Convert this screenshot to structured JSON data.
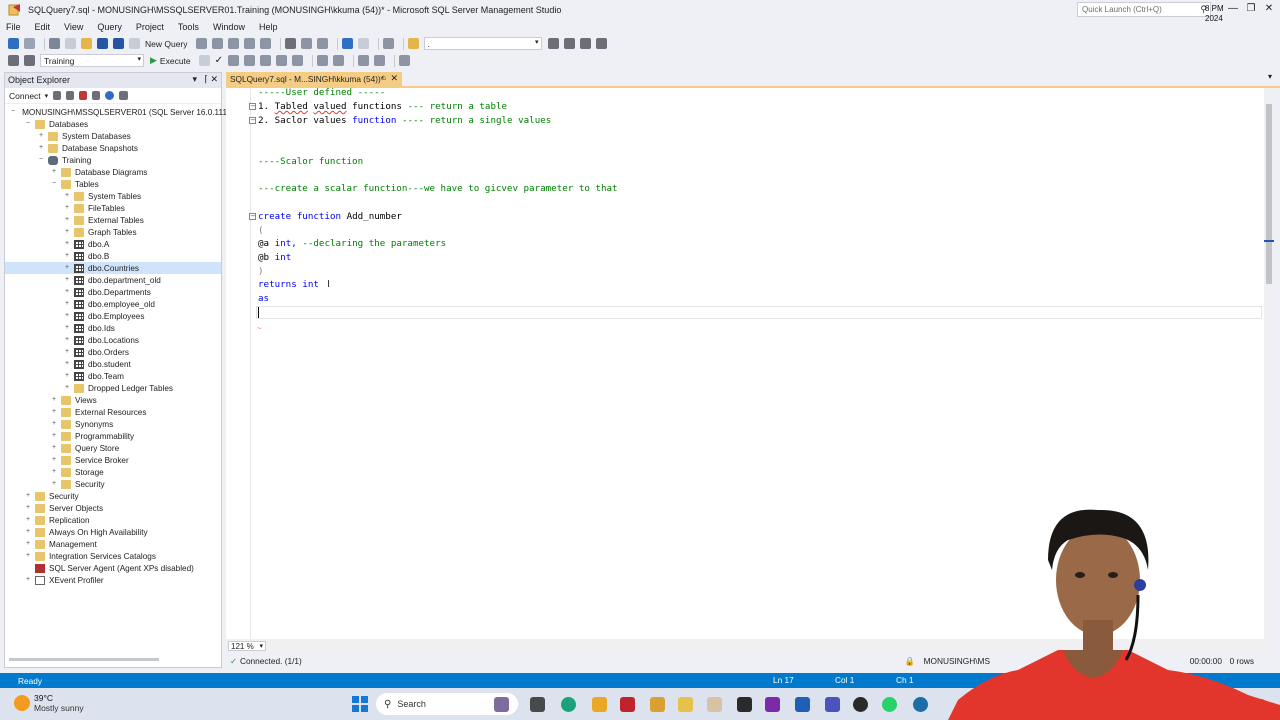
{
  "window": {
    "title": "SQLQuery7.sql - MONUSINGH\\MSSQLSERVER01.Training (MONUSINGH\\kkuma (54))* - Microsoft SQL Server Management Studio",
    "quick_launch_placeholder": "Quick Launch (Ctrl+Q)"
  },
  "menu": [
    "File",
    "Edit",
    "View",
    "Query",
    "Project",
    "Tools",
    "Window",
    "Help"
  ],
  "toolbar": {
    "new_query": "New Query",
    "database_combo": "Training",
    "execute": "Execute",
    "solution_combo": "."
  },
  "object_explorer": {
    "title": "Object Explorer",
    "connect": "Connect",
    "nodes": [
      {
        "label": "MONUSINGH\\MSSQLSERVER01 (SQL Server 16.0.1115",
        "depth": 0,
        "expander": "−",
        "icon": "server"
      },
      {
        "label": "Databases",
        "depth": 1,
        "expander": "−",
        "icon": "folder"
      },
      {
        "label": "System Databases",
        "depth": 2,
        "expander": "+",
        "icon": "folder"
      },
      {
        "label": "Database Snapshots",
        "depth": 2,
        "expander": "+",
        "icon": "folder"
      },
      {
        "label": "Training",
        "depth": 2,
        "expander": "−",
        "icon": "db"
      },
      {
        "label": "Database Diagrams",
        "depth": 3,
        "expander": "+",
        "icon": "folder"
      },
      {
        "label": "Tables",
        "depth": 3,
        "expander": "−",
        "icon": "folder"
      },
      {
        "label": "System Tables",
        "depth": 4,
        "expander": "+",
        "icon": "folder"
      },
      {
        "label": "FileTables",
        "depth": 4,
        "expander": "+",
        "icon": "folder"
      },
      {
        "label": "External Tables",
        "depth": 4,
        "expander": "+",
        "icon": "folder"
      },
      {
        "label": "Graph Tables",
        "depth": 4,
        "expander": "+",
        "icon": "folder"
      },
      {
        "label": "dbo.A",
        "depth": 4,
        "expander": "+",
        "icon": "table"
      },
      {
        "label": "dbo.B",
        "depth": 4,
        "expander": "+",
        "icon": "table"
      },
      {
        "label": "dbo.Countries",
        "depth": 4,
        "expander": "+",
        "icon": "table",
        "selected": true
      },
      {
        "label": "dbo.department_old",
        "depth": 4,
        "expander": "+",
        "icon": "table"
      },
      {
        "label": "dbo.Departments",
        "depth": 4,
        "expander": "+",
        "icon": "table"
      },
      {
        "label": "dbo.employee_old",
        "depth": 4,
        "expander": "+",
        "icon": "table"
      },
      {
        "label": "dbo.Employees",
        "depth": 4,
        "expander": "+",
        "icon": "table"
      },
      {
        "label": "dbo.Ids",
        "depth": 4,
        "expander": "+",
        "icon": "table"
      },
      {
        "label": "dbo.Locations",
        "depth": 4,
        "expander": "+",
        "icon": "table"
      },
      {
        "label": "dbo.Orders",
        "depth": 4,
        "expander": "+",
        "icon": "table"
      },
      {
        "label": "dbo.student",
        "depth": 4,
        "expander": "+",
        "icon": "table"
      },
      {
        "label": "dbo.Team",
        "depth": 4,
        "expander": "+",
        "icon": "table"
      },
      {
        "label": "Dropped Ledger Tables",
        "depth": 4,
        "expander": "+",
        "icon": "folder"
      },
      {
        "label": "Views",
        "depth": 3,
        "expander": "+",
        "icon": "folder"
      },
      {
        "label": "External Resources",
        "depth": 3,
        "expander": "+",
        "icon": "folder"
      },
      {
        "label": "Synonyms",
        "depth": 3,
        "expander": "+",
        "icon": "folder"
      },
      {
        "label": "Programmability",
        "depth": 3,
        "expander": "+",
        "icon": "folder"
      },
      {
        "label": "Query Store",
        "depth": 3,
        "expander": "+",
        "icon": "folder"
      },
      {
        "label": "Service Broker",
        "depth": 3,
        "expander": "+",
        "icon": "folder"
      },
      {
        "label": "Storage",
        "depth": 3,
        "expander": "+",
        "icon": "folder"
      },
      {
        "label": "Security",
        "depth": 3,
        "expander": "+",
        "icon": "folder"
      },
      {
        "label": "Security",
        "depth": 1,
        "expander": "+",
        "icon": "folder"
      },
      {
        "label": "Server Objects",
        "depth": 1,
        "expander": "+",
        "icon": "folder"
      },
      {
        "label": "Replication",
        "depth": 1,
        "expander": "+",
        "icon": "folder"
      },
      {
        "label": "Always On High Availability",
        "depth": 1,
        "expander": "+",
        "icon": "folder"
      },
      {
        "label": "Management",
        "depth": 1,
        "expander": "+",
        "icon": "folder"
      },
      {
        "label": "Integration Services Catalogs",
        "depth": 1,
        "expander": "+",
        "icon": "folder"
      },
      {
        "label": "SQL Server Agent (Agent XPs disabled)",
        "depth": 1,
        "expander": "",
        "icon": "agent"
      },
      {
        "label": "XEvent Profiler",
        "depth": 1,
        "expander": "+",
        "icon": "xe"
      }
    ]
  },
  "editor": {
    "tab_title": "SQLQuery7.sql - M...SINGH\\kkuma (54))*",
    "zoom": "121 %",
    "lines": {
      "l1": "-----User defined -----",
      "l2_num": "1.",
      "l2_a": "Tabled",
      "l2_b": "valued",
      "l2_c": "functions",
      "l2_d": "--- return a table",
      "l3_num": "2.",
      "l3_a": "Saclor",
      "l3_b": "values",
      "l3_c": "function",
      "l3_d": "---- return a single values",
      "l4": "----Scalor function",
      "l5": "---create a scalar function---we have to gicvev parameter to that",
      "l6_kw1": "create",
      "l6_kw2": "function",
      "l6_name": "Add_number",
      "l7": "(",
      "l8_var": "@a",
      "l8_kw": "int,",
      "l8_cm": "--declaring the parameters",
      "l9_var": "@b",
      "l9_kw": "int",
      "l10": ")",
      "l11_kw1": "returns",
      "l11_kw2": "int",
      "l12": "as"
    }
  },
  "query_status": {
    "connected": "Connected. (1/1)",
    "server": "MONUSINGH\\MS",
    "time": "00:00:00",
    "rows": "0 rows"
  },
  "status": {
    "ready": "Ready",
    "ln": "Ln 17",
    "col": "Col 1",
    "ch": "Ch 1"
  },
  "taskbar": {
    "temperature": "39°C",
    "condition": "Mostly sunny",
    "search": "Search",
    "clock_fragment": "8 PM",
    "date_fragment": "2024"
  }
}
